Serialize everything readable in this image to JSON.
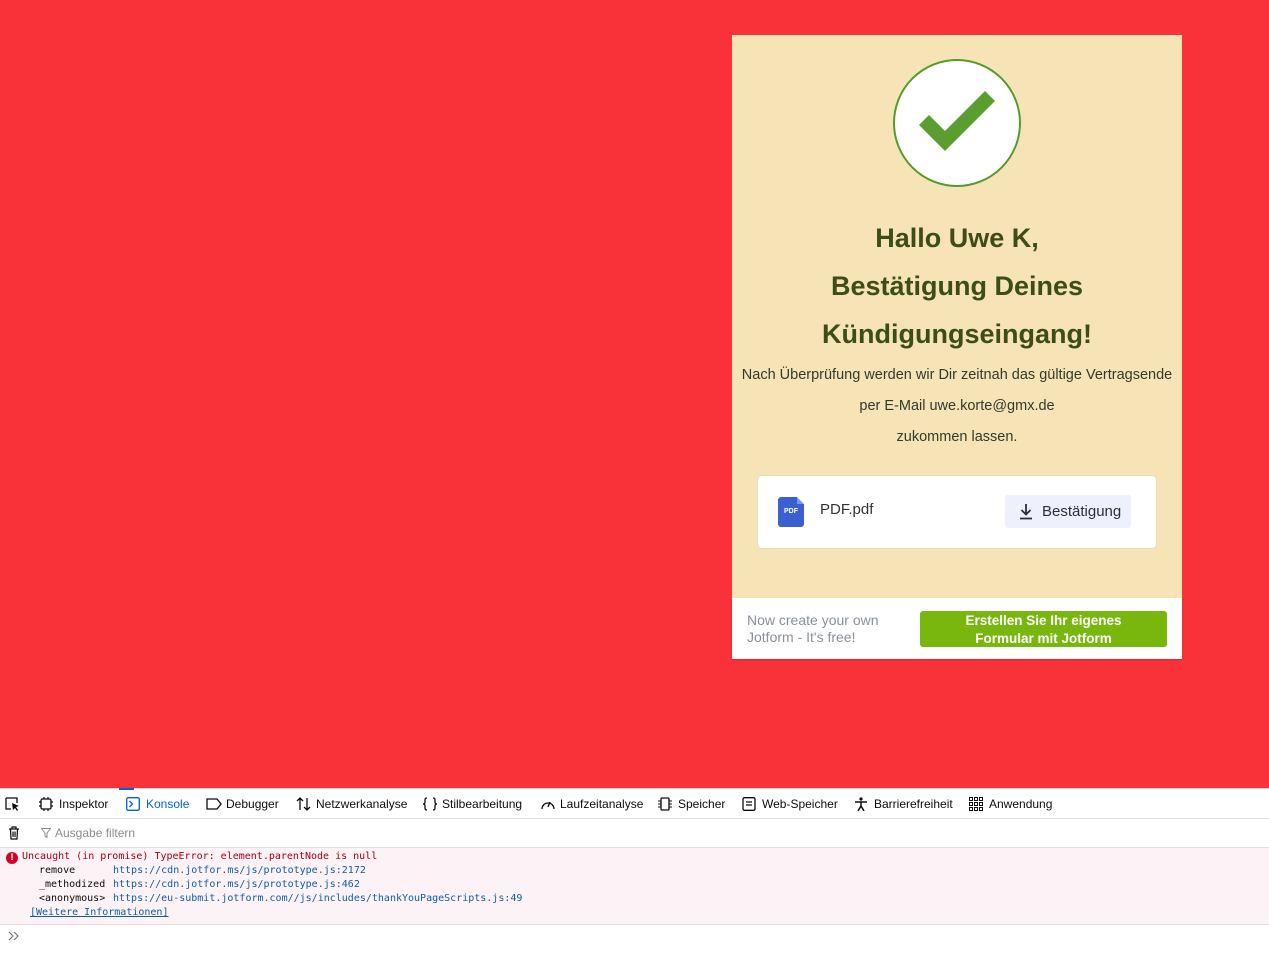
{
  "card": {
    "heading_lines": [
      "Hallo Uwe K,",
      "Bestätigung Deines",
      "Kündigungseingang!"
    ],
    "body_lines": [
      "Nach Überprüfung werden wir Dir zeitnah das gültige Vertragsende",
      "per E-Mail uwe.korte@gmx.de",
      "zukommen lassen."
    ],
    "file": {
      "icon_label": "PDF",
      "name": "PDF.pdf",
      "download_label": "Bestätigung"
    }
  },
  "footer": {
    "promo_line1": "Now create your own",
    "promo_line2": "Jotform - It's free!",
    "button_line1": "Erstellen Sie Ihr eigenes",
    "button_line2": "Formular mit Jotform"
  },
  "devtools": {
    "tabs": [
      "Inspektor",
      "Konsole",
      "Debugger",
      "Netzwerkanalyse",
      "Stilbearbeitung",
      "Laufzeitanalyse",
      "Speicher",
      "Web-Speicher",
      "Barrierefreiheit",
      "Anwendung"
    ],
    "active_tab": "Konsole",
    "filter_placeholder": "Ausgabe filtern",
    "error": {
      "message": "Uncaught (in promise) TypeError: element.parentNode is null",
      "stack": [
        {
          "fn": "remove",
          "url": "https://cdn.jotfor.ms/js/prototype.js:2172"
        },
        {
          "fn": "_methodized",
          "url": "https://cdn.jotfor.ms/js/prototype.js:462"
        },
        {
          "fn": "<anonymous>",
          "url": "https://eu-submit.jotform.com//js/includes/thankYouPageScripts.js:49"
        }
      ],
      "more_link": "[Weitere Informationen]"
    }
  },
  "colors": {
    "page_background": "#f83238",
    "card_background": "#f6e3b6",
    "heading": "#3c4d17",
    "check": "#5a9e2f",
    "cta_button": "#79b70e",
    "devtools_active": "#0060df",
    "error_text": "#a4000f"
  }
}
